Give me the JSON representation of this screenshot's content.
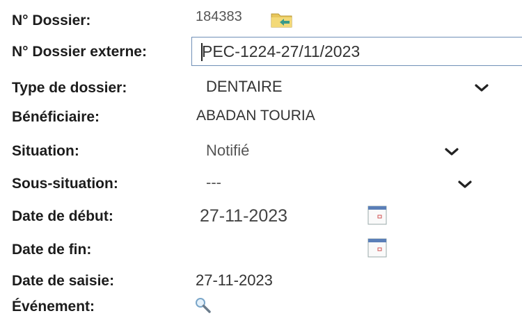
{
  "fields": {
    "dossier": {
      "label": "N° Dossier:",
      "value": "184383",
      "icon": "folder-icon"
    },
    "dossier_externe": {
      "label": "N° Dossier externe:",
      "value": "PEC-1224-27/11/2023"
    },
    "type_dossier": {
      "label": "Type de dossier:",
      "value": "DENTAIRE"
    },
    "beneficiaire": {
      "label": "Bénéficiaire:",
      "value": "ABADAN TOURIA"
    },
    "situation": {
      "label": "Situation:",
      "value": "Notifié"
    },
    "sous_situation": {
      "label": "Sous-situation:",
      "value": "---"
    },
    "date_debut": {
      "label": "Date de début:",
      "value": "27-11-2023",
      "icon": "calendar-icon"
    },
    "date_fin": {
      "label": "Date de fin:",
      "value": "",
      "icon": "calendar-icon"
    },
    "date_saisie": {
      "label": "Date de saisie:",
      "value": "27-11-2023"
    },
    "evenement": {
      "label": "Événement:",
      "icon": "search-icon"
    }
  },
  "colors": {
    "input_border": "#6f8fb6",
    "label_text": "#1c1c1c",
    "value_text": "#333333"
  }
}
